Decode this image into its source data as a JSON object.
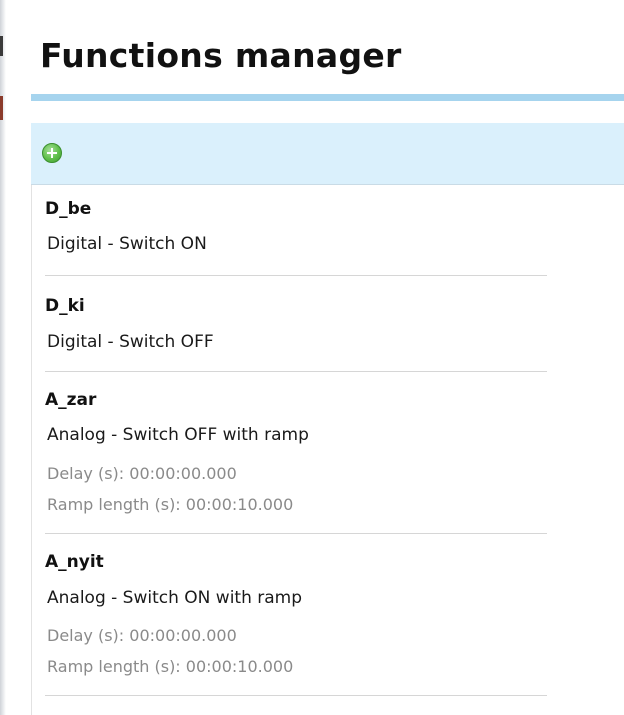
{
  "page": {
    "title": "Functions manager"
  },
  "toolbar": {
    "add_icon": "add-circle-icon",
    "accent_color": "#daf0fc",
    "underline_color": "#a6d4ee",
    "add_icon_color": "#5fbf4a"
  },
  "functions": [
    {
      "name": "D_be",
      "type": "Digital - Switch ON"
    },
    {
      "name": "D_ki",
      "type": "Digital - Switch OFF"
    },
    {
      "name": "A_zar",
      "type": "Analog - Switch OFF with ramp",
      "delay": "Delay (s): 00:00:00.000",
      "ramp_length": "Ramp length (s): 00:00:10.000"
    },
    {
      "name": "A_nyit",
      "type": "Analog - Switch ON with ramp",
      "delay": "Delay (s): 00:00:00.000",
      "ramp_length": "Ramp length (s): 00:00:10.000"
    }
  ]
}
